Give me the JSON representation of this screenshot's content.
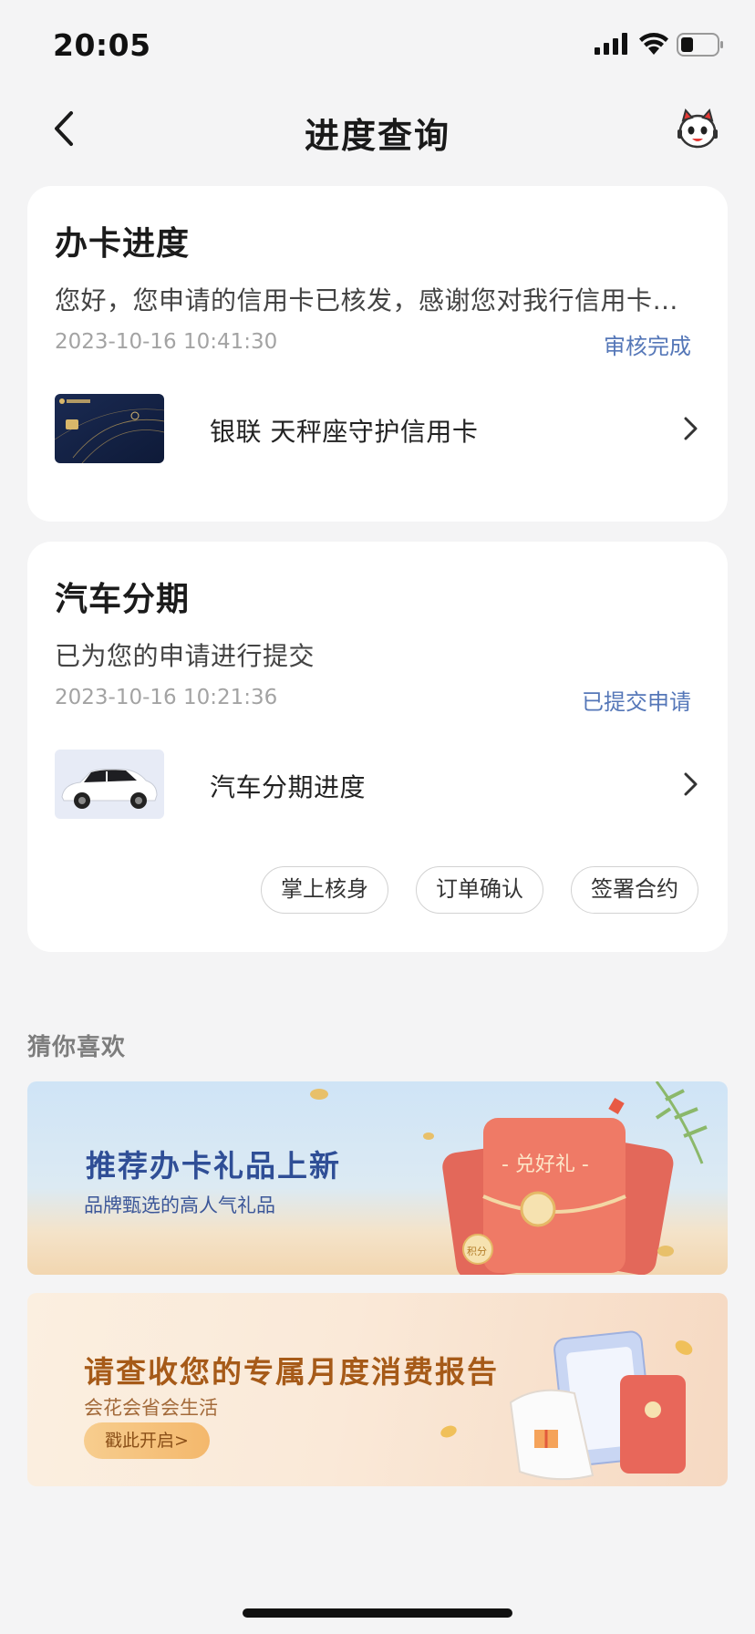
{
  "status_bar": {
    "time": "20:05"
  },
  "nav": {
    "title": "进度查询"
  },
  "card_progress": {
    "title": "办卡进度",
    "message": "您好，您申请的信用卡已核发，感谢您对我行信用卡的…",
    "time": "2023-10-16 10:41:30",
    "status": "审核完成",
    "item_label": "银联 天秤座守护信用卡",
    "colors": {
      "status": "#5577b8"
    }
  },
  "card_auto": {
    "title": "汽车分期",
    "message": "已为您的申请进行提交",
    "time": "2023-10-16 10:21:36",
    "status": "已提交申请",
    "item_label": "汽车分期进度",
    "actions": [
      "掌上核身",
      "订单确认",
      "签署合约"
    ]
  },
  "recommend": {
    "title": "猜你喜欢",
    "banners": [
      {
        "title": "推荐办卡礼品上新",
        "subtitle": "品牌甄选的高人气礼品",
        "art_text": "- 兑好礼 -",
        "art_badge": "积分"
      },
      {
        "title": "请查收您的专属月度消费报告",
        "subtitle": "会花会省会生活",
        "button": "戳此开启>"
      }
    ]
  }
}
